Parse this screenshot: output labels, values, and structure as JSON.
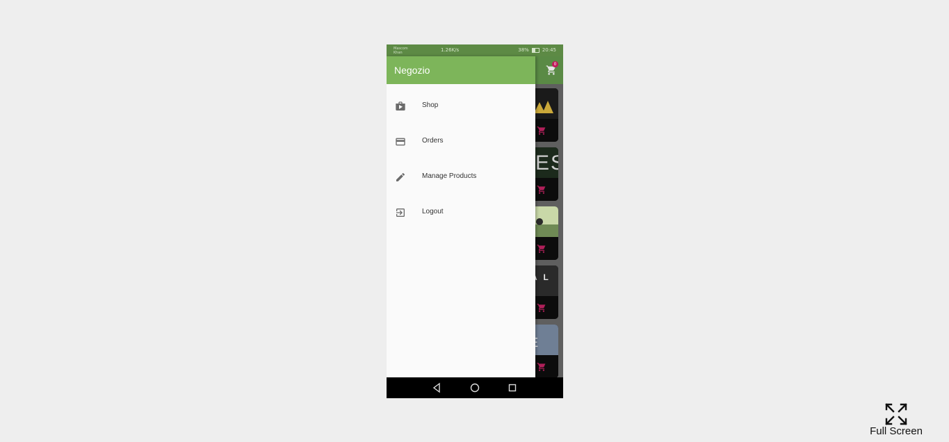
{
  "status_bar": {
    "carrier_line1": "Mascom",
    "carrier_line2": "Khan",
    "speed": "1.26K/s",
    "battery": "38%",
    "time": "20:45"
  },
  "appbar": {
    "cart_badge": "0"
  },
  "drawer": {
    "title": "Negozio",
    "items": [
      {
        "label": "Shop",
        "icon": "shop-icon"
      },
      {
        "label": "Orders",
        "icon": "credit-card-icon"
      },
      {
        "label": "Manage Products",
        "icon": "pencil-icon"
      },
      {
        "label": "Logout",
        "icon": "logout-icon"
      }
    ]
  },
  "grid_text": {
    "card2": "ES",
    "card4": "A L",
    "card5": "E"
  },
  "colors": {
    "drawer_header": "#7db55a",
    "status_bar": "#5d8a45",
    "cart_accent": "#c2185b"
  },
  "fullscreen": {
    "label": "Full Screen"
  }
}
